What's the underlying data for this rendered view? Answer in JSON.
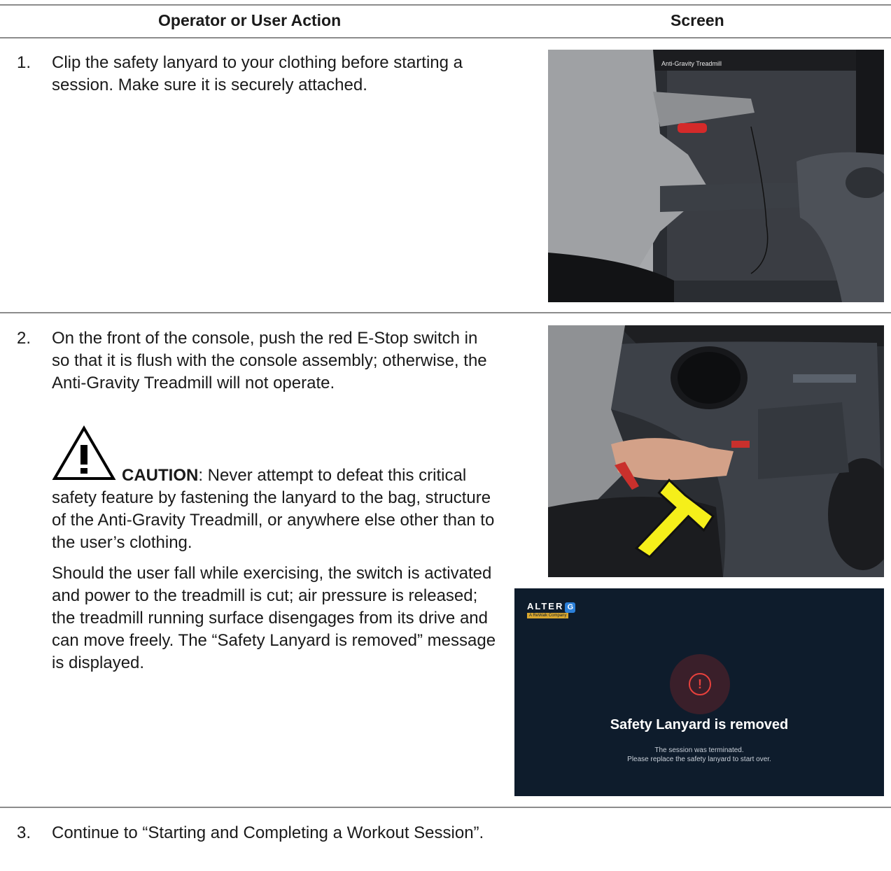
{
  "table": {
    "header_left": "Operator or User Action",
    "header_right": "Screen"
  },
  "steps": [
    {
      "num": "1.",
      "text": "Clip the safety lanyard to your clothing before starting a session. Make sure it is securely attached."
    },
    {
      "num": "2.",
      "text": "On the front of the console, push the red E-Stop switch in so that it is flush with the console assembly; otherwise, the Anti-Gravity Treadmill will not operate."
    },
    {
      "num": "3.",
      "text": "Continue to “Starting and Completing a Workout Session”."
    }
  ],
  "caution": {
    "label": "CAUTION",
    "text": ": Never attempt to defeat this critical safety feature by fastening the lanyard to the bag, structure of the Anti-Gravity Treadmill, or anywhere else other than to the user’s clothing."
  },
  "fall_paragraph": "Should the user fall while exercising, the switch is activated and power to the treadmill is cut; air pressure is released; the treadmill running surface disengages from its drive and can move freely. The “Safety Lanyard is removed” message is displayed.",
  "photo1": {
    "label": "Anti-Gravity Treadmill"
  },
  "screen": {
    "logo": "ALTER",
    "logo_g": "G",
    "logo_sub": "A ReWalk Company",
    "alert_glyph": "!",
    "title": "Safety Lanyard is removed",
    "line1": "The session was terminated.",
    "line2": "Please replace the safety lanyard to start over."
  }
}
